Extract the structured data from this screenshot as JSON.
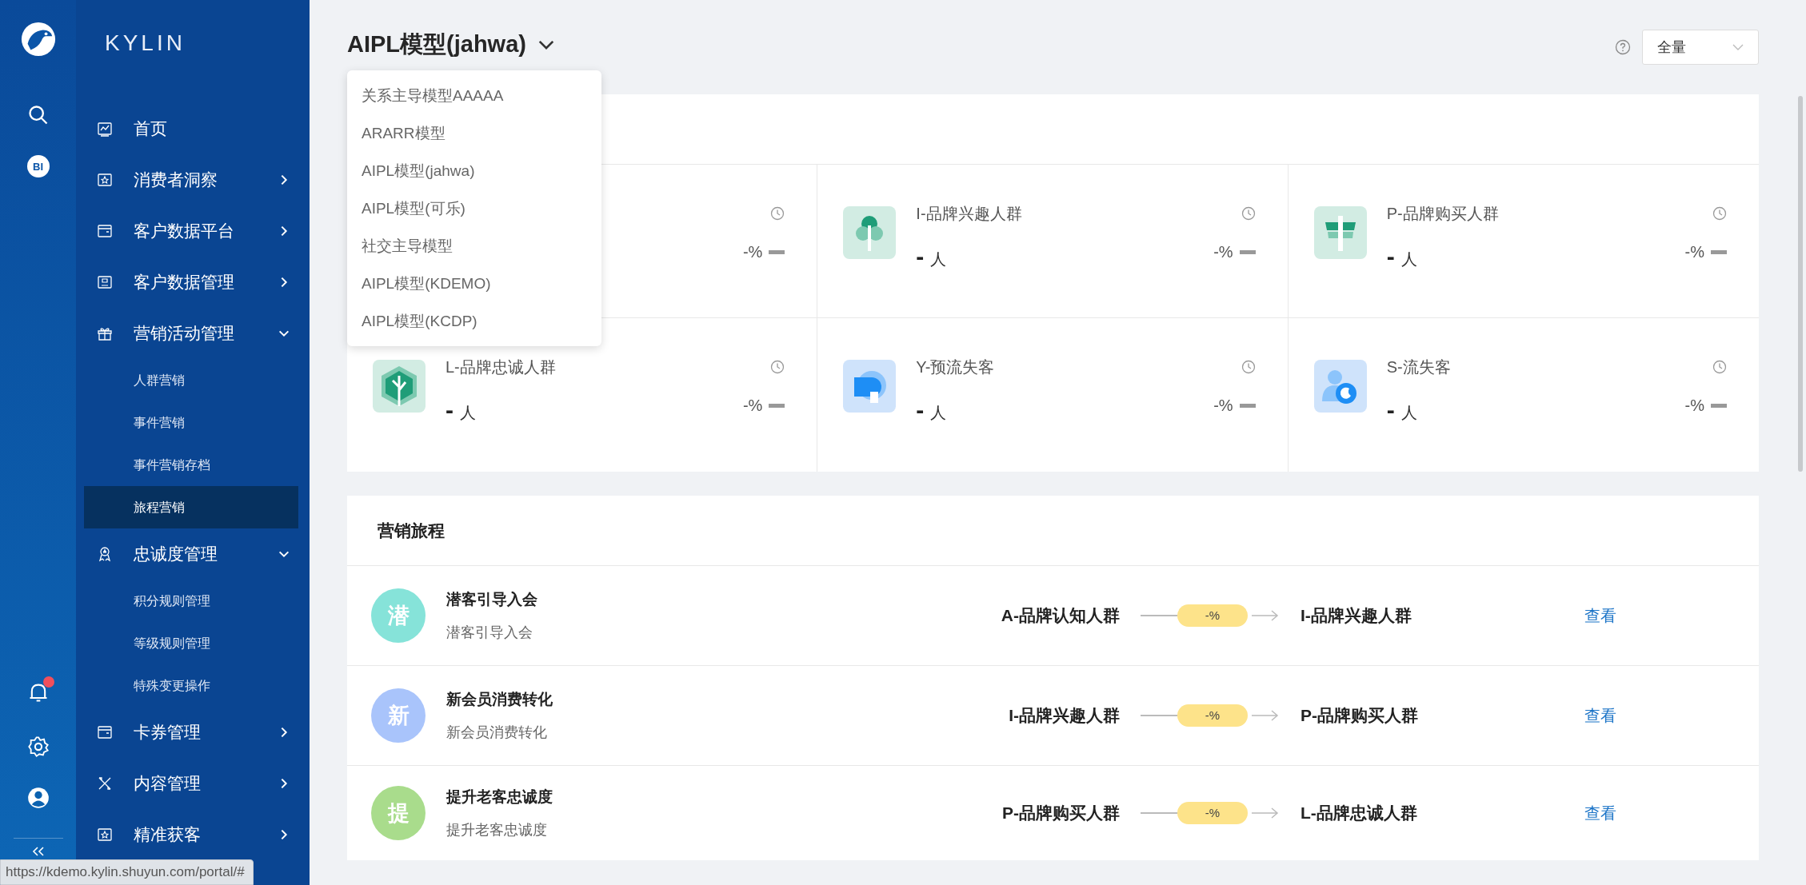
{
  "brand": "KYLIN",
  "rail": {
    "notification_dot": true,
    "bi_label": "BI"
  },
  "menu": [
    {
      "label": "首页",
      "kind": "link"
    },
    {
      "label": "消费者洞察",
      "kind": "group",
      "expanded": false
    },
    {
      "label": "客户数据平台",
      "kind": "group",
      "expanded": false
    },
    {
      "label": "客户数据管理",
      "kind": "group",
      "expanded": false
    },
    {
      "label": "营销活动管理",
      "kind": "group",
      "expanded": true,
      "children": [
        {
          "label": "人群营销",
          "selected": false
        },
        {
          "label": "事件营销",
          "selected": false
        },
        {
          "label": "事件营销存档",
          "selected": false
        },
        {
          "label": "旅程营销",
          "selected": true
        }
      ]
    },
    {
      "label": "忠诚度管理",
      "kind": "group",
      "expanded": true,
      "children": [
        {
          "label": "积分规则管理",
          "selected": false
        },
        {
          "label": "等级规则管理",
          "selected": false
        },
        {
          "label": "特殊变更操作",
          "selected": false
        }
      ]
    },
    {
      "label": "卡券管理",
      "kind": "group",
      "expanded": false
    },
    {
      "label": "内容管理",
      "kind": "group",
      "expanded": false
    },
    {
      "label": "精准获客",
      "kind": "group",
      "expanded": false
    }
  ],
  "model_selector": {
    "value": "AIPL模型(jahwa)",
    "options": [
      "关系主导模型AAAAA",
      "ARARR模型",
      "AIPL模型(jahwa)",
      "AIPL模型(可乐)",
      "社交主导模型",
      "AIPL模型(KDEMO)",
      "AIPL模型(KCDP)"
    ]
  },
  "scope_select": {
    "value": "全量"
  },
  "segments": [
    {
      "change": "-%"
    },
    {
      "title": "I-品牌兴趣人群",
      "count": "-",
      "unit": "人",
      "change": "-%"
    },
    {
      "title": "P-品牌购买人群",
      "count": "-",
      "unit": "人",
      "change": "-%"
    },
    {
      "title": "L-品牌忠诚人群",
      "count": "-",
      "unit": "人",
      "change": "-%"
    },
    {
      "title": "Y-预流失客",
      "count": "-",
      "unit": "人",
      "change": "-%"
    },
    {
      "title": "S-流失客",
      "count": "-",
      "unit": "人",
      "change": "-%"
    }
  ],
  "journey": {
    "title": "营销旅程",
    "rows": [
      {
        "badge": "潜",
        "color": "#86e3d9",
        "name": "潜客引导入会",
        "description": "潜客引导入会",
        "from": "A-品牌认知人群",
        "rate": "-%",
        "to": "I-品牌兴趣人群",
        "action": "查看"
      },
      {
        "badge": "新",
        "color": "#a9c4fb",
        "name": "新会员消费转化",
        "description": "新会员消费转化",
        "from": "I-品牌兴趣人群",
        "rate": "-%",
        "to": "P-品牌购买人群",
        "action": "查看"
      },
      {
        "badge": "提",
        "color": "#a9dc8c",
        "name": "提升老客忠诚度",
        "description": "提升老客忠诚度",
        "from": "P-品牌购买人群",
        "rate": "-%",
        "to": "L-品牌忠诚人群",
        "action": "查看"
      }
    ]
  },
  "status_url": "https://kdemo.kylin.shuyun.com/portal/#"
}
